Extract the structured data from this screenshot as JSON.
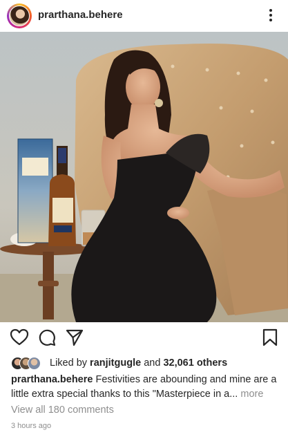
{
  "post": {
    "username": "prarthana.behere",
    "image_alt": "Woman in black dress seated in tufted armchair beside a Blenders Pride whisky bottle and glass"
  },
  "product": {
    "box_brand": "BLENDER'S PRIDE",
    "box_sub": "Reserve Collection",
    "box_type": "WHISKY",
    "bottle_brand": "BLENDER'S PRIDE"
  },
  "likes": {
    "prefix": "Liked by",
    "user": "ranjitgugle",
    "connector": "and",
    "others": "32,061 others"
  },
  "caption": {
    "username": "prarthana.behere",
    "text": "Festivities are abounding and mine are a little extra special thanks to this \"Masterpiece in a...",
    "more": "more"
  },
  "comments_link": "View all 180 comments",
  "timestamp": "3 hours ago",
  "icons": [
    "heart-icon",
    "comment-icon",
    "share-icon",
    "bookmark-icon",
    "more-options-icon"
  ]
}
